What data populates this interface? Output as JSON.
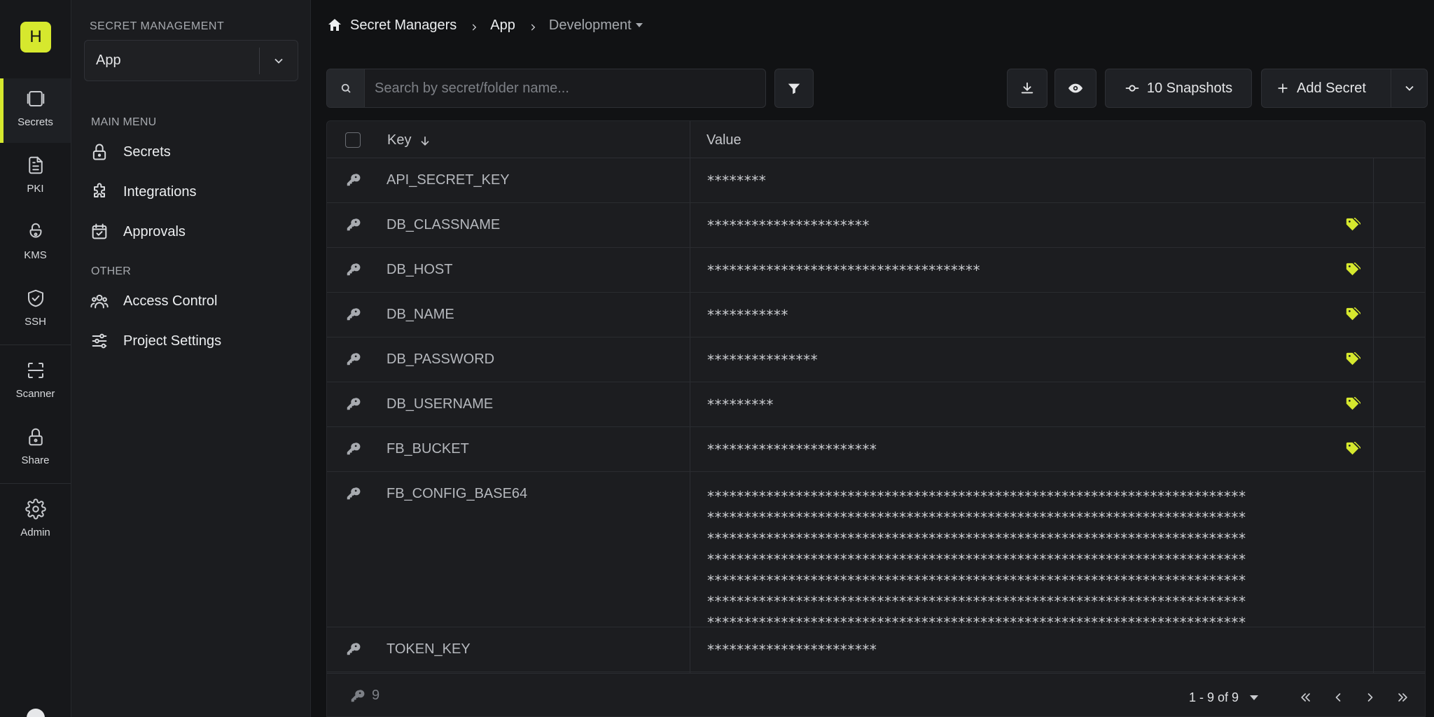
{
  "rail": {
    "org_initial": "H",
    "items": [
      {
        "label": "Secrets",
        "icon": "vault-icon",
        "active": true
      },
      {
        "label": "PKI",
        "icon": "document-icon"
      },
      {
        "label": "KMS",
        "icon": "lock-open-icon"
      },
      {
        "label": "SSH",
        "icon": "shield-check-icon"
      },
      {
        "label": "Scanner",
        "icon": "scan-icon"
      },
      {
        "label": "Share",
        "icon": "lock-icon"
      },
      {
        "label": "Admin",
        "icon": "gear-icon"
      }
    ]
  },
  "sidebar": {
    "heading": "SECRET MANAGEMENT",
    "project_value": "App",
    "main_menu_label": "MAIN MENU",
    "main_menu": [
      {
        "label": "Secrets",
        "icon": "lock-icon"
      },
      {
        "label": "Integrations",
        "icon": "puzzle-icon"
      },
      {
        "label": "Approvals",
        "icon": "calendar-check-icon"
      }
    ],
    "other_label": "OTHER",
    "other_menu": [
      {
        "label": "Access Control",
        "icon": "users-icon"
      },
      {
        "label": "Project Settings",
        "icon": "sliders-icon"
      }
    ]
  },
  "breadcrumb": {
    "root": "Secret Managers",
    "project": "App",
    "environment": "Development"
  },
  "toolbar": {
    "search_placeholder": "Search by secret/folder name...",
    "snapshots_label": "10 Snapshots",
    "add_secret_label": "Add Secret"
  },
  "table": {
    "key_header": "Key",
    "value_header": "Value",
    "rows": [
      {
        "key": "API_SECRET_KEY",
        "value": "********",
        "tagged": false
      },
      {
        "key": "DB_CLASSNAME",
        "value": "**********************",
        "tagged": true
      },
      {
        "key": "DB_HOST",
        "value": "*************************************",
        "tagged": true
      },
      {
        "key": "DB_NAME",
        "value": "***********",
        "tagged": true
      },
      {
        "key": "DB_PASSWORD",
        "value": "***************",
        "tagged": true
      },
      {
        "key": "DB_USERNAME",
        "value": "*********",
        "tagged": true
      },
      {
        "key": "FB_BUCKET",
        "value": "***********************",
        "tagged": true
      },
      {
        "key": "FB_CONFIG_BASE64",
        "value": "*************************************************************************\n*************************************************************************\n*************************************************************************\n*************************************************************************\n*************************************************************************\n*************************************************************************\n*************************************************************************",
        "tagged": false
      },
      {
        "key": "TOKEN_KEY",
        "value": "***********************",
        "tagged": false
      }
    ],
    "footer_count": "9",
    "pagination_text": "1 - 9 of 9"
  },
  "colors": {
    "accent": "#d6e82e",
    "background": "#111214",
    "panel": "#1c1d20"
  }
}
